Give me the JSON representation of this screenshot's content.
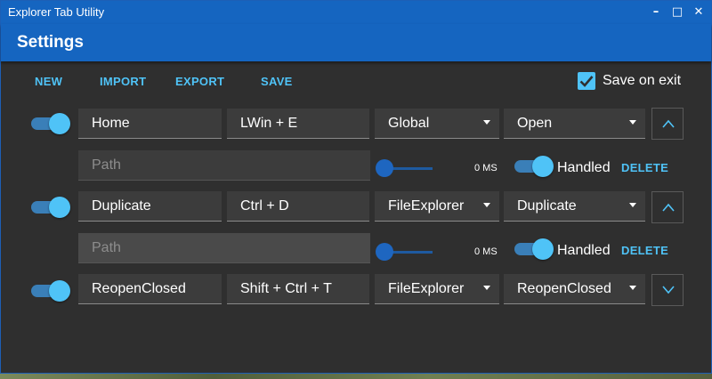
{
  "window": {
    "title": "Explorer Tab Utility",
    "controls": {
      "minimize": "–",
      "maximize": "□",
      "close": "✕"
    }
  },
  "header": {
    "title": "Settings"
  },
  "toolbar": {
    "new_label": "NEW",
    "import_label": "IMPORT",
    "export_label": "EXPORT",
    "save_label": "SAVE",
    "save_on_exit_label": "Save on exit",
    "save_on_exit_checked": true
  },
  "hotkeys": [
    {
      "enabled": true,
      "name": "Home",
      "keys": "LWin + E",
      "scope": "Global",
      "action": "Open",
      "move_icon": "chevron-up-icon",
      "path_placeholder": "Path",
      "delay": "0 MS",
      "handled_label": "Handled",
      "handled": true,
      "delete_label": "DELETE"
    },
    {
      "enabled": true,
      "name": "Duplicate",
      "keys": "Ctrl + D",
      "scope": "FileExplorer",
      "action": "Duplicate",
      "move_icon": "chevron-up-icon",
      "path_placeholder": "Path",
      "delay": "0 MS",
      "handled_label": "Handled",
      "handled": true,
      "delete_label": "DELETE"
    },
    {
      "enabled": true,
      "name": "ReopenClosed",
      "keys": "Shift + Ctrl + T",
      "scope": "FileExplorer",
      "action": "ReopenClosed",
      "move_icon": "chevron-down-icon"
    }
  ],
  "colors": {
    "accent": "#4fc3f7",
    "titlebar": "#1565c0",
    "background": "#2f2f2f",
    "field": "#3c3c3c"
  }
}
